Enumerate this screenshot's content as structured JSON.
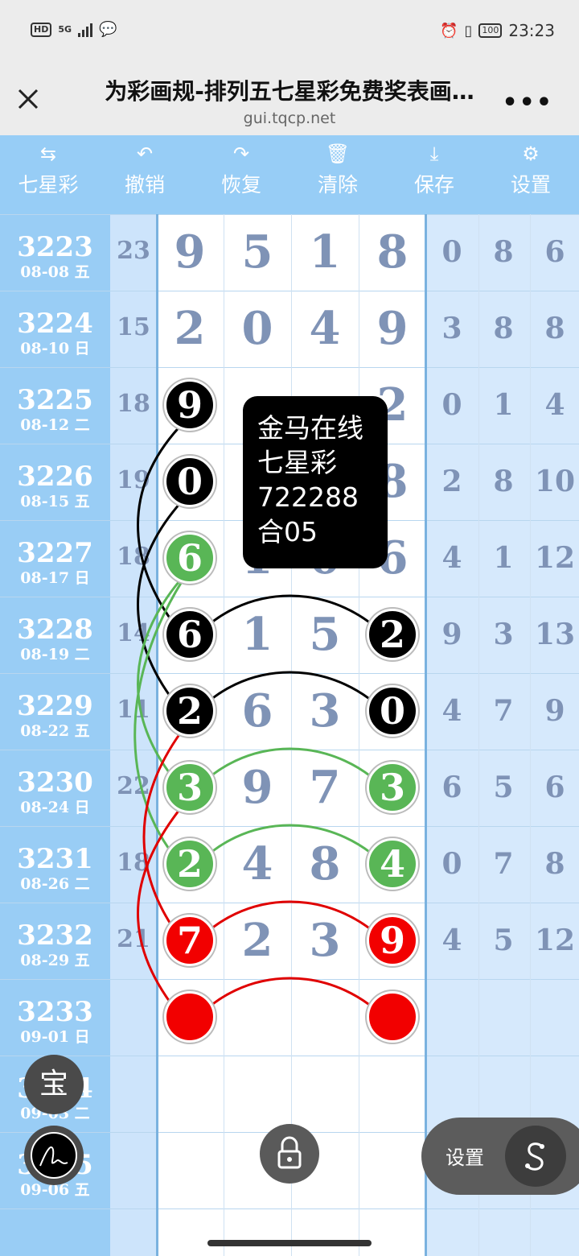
{
  "status_bar": {
    "hd": "HD",
    "signal": "5G",
    "time": "23:23",
    "battery": "100"
  },
  "header": {
    "title": "为彩画规-排列五七星彩免费奖表画…",
    "url": "gui.tqcp.net",
    "more": "•••"
  },
  "toolbar": [
    {
      "icon": "swap-icon",
      "glyph": "⇆",
      "label": "七星彩"
    },
    {
      "icon": "undo-icon",
      "glyph": "↶",
      "label": "撤销"
    },
    {
      "icon": "redo-icon",
      "glyph": "↷",
      "label": "恢复"
    },
    {
      "icon": "trash-icon",
      "glyph": "🗑",
      "label": "清除"
    },
    {
      "icon": "download-icon",
      "glyph": "⤓",
      "label": "保存"
    },
    {
      "icon": "gear-icon",
      "glyph": "⚙",
      "label": "设置"
    }
  ],
  "rows": [
    {
      "issue": "3223",
      "date": "08-08 五",
      "sum": "23",
      "main": [
        "9",
        "5",
        "1",
        "8"
      ],
      "right": [
        "0",
        "8",
        "6"
      ]
    },
    {
      "issue": "3224",
      "date": "08-10 日",
      "sum": "15",
      "main": [
        "2",
        "0",
        "4",
        "9"
      ],
      "right": [
        "3",
        "8",
        "8"
      ]
    },
    {
      "issue": "3225",
      "date": "08-12 二",
      "sum": "18",
      "main": [
        "",
        "",
        "",
        "2"
      ],
      "right": [
        "0",
        "1",
        "4"
      ]
    },
    {
      "issue": "3226",
      "date": "08-15 五",
      "sum": "19",
      "main": [
        "",
        "",
        "",
        "8"
      ],
      "right": [
        "2",
        "8",
        "10"
      ]
    },
    {
      "issue": "3227",
      "date": "08-17 日",
      "sum": "18",
      "main": [
        "",
        "1",
        "0",
        "6"
      ],
      "right": [
        "4",
        "1",
        "12"
      ]
    },
    {
      "issue": "3228",
      "date": "08-19 二",
      "sum": "14",
      "main": [
        "",
        "1",
        "5",
        ""
      ],
      "right": [
        "9",
        "3",
        "13"
      ]
    },
    {
      "issue": "3229",
      "date": "08-22 五",
      "sum": "11",
      "main": [
        "",
        "6",
        "3",
        ""
      ],
      "right": [
        "4",
        "7",
        "9"
      ]
    },
    {
      "issue": "3230",
      "date": "08-24 日",
      "sum": "22",
      "main": [
        "",
        "9",
        "7",
        ""
      ],
      "right": [
        "6",
        "5",
        "6"
      ]
    },
    {
      "issue": "3231",
      "date": "08-26 二",
      "sum": "18",
      "main": [
        "",
        "4",
        "8",
        ""
      ],
      "right": [
        "0",
        "7",
        "8"
      ]
    },
    {
      "issue": "3232",
      "date": "08-29 五",
      "sum": "21",
      "main": [
        "",
        "2",
        "3",
        ""
      ],
      "right": [
        "4",
        "5",
        "12"
      ]
    },
    {
      "issue": "3233",
      "date": "09-01 日",
      "sum": "",
      "main": [
        "",
        "",
        "",
        ""
      ],
      "right": [
        "",
        "",
        ""
      ]
    },
    {
      "issue": "3234",
      "date": "09-03 二",
      "sum": "",
      "main": [
        "",
        "",
        "",
        ""
      ],
      "right": [
        "",
        "",
        ""
      ]
    },
    {
      "issue": "3235",
      "date": "09-06 五",
      "sum": "",
      "main": [
        "",
        "",
        "",
        ""
      ],
      "right": [
        "",
        "",
        ""
      ]
    }
  ],
  "balls": [
    {
      "row": 2,
      "col": 0,
      "value": "9",
      "color": "black"
    },
    {
      "row": 3,
      "col": 0,
      "value": "0",
      "color": "black"
    },
    {
      "row": 4,
      "col": 0,
      "value": "6",
      "color": "green"
    },
    {
      "row": 5,
      "col": 0,
      "value": "6",
      "color": "black"
    },
    {
      "row": 5,
      "col": 3,
      "value": "2",
      "color": "black"
    },
    {
      "row": 6,
      "col": 0,
      "value": "2",
      "color": "black"
    },
    {
      "row": 6,
      "col": 3,
      "value": "0",
      "color": "black"
    },
    {
      "row": 7,
      "col": 0,
      "value": "3",
      "color": "green"
    },
    {
      "row": 7,
      "col": 3,
      "value": "3",
      "color": "green"
    },
    {
      "row": 8,
      "col": 0,
      "value": "2",
      "color": "green"
    },
    {
      "row": 8,
      "col": 3,
      "value": "4",
      "color": "green"
    },
    {
      "row": 9,
      "col": 0,
      "value": "7",
      "color": "red"
    },
    {
      "row": 9,
      "col": 3,
      "value": "9",
      "color": "red"
    },
    {
      "row": 10,
      "col": 0,
      "value": "",
      "color": "red"
    },
    {
      "row": 10,
      "col": 3,
      "value": "",
      "color": "red"
    }
  ],
  "tooltip": {
    "line1": "金马在线",
    "line2": "七星彩",
    "line3": "722288",
    "line4": "合05"
  },
  "floating": {
    "bao": "宝",
    "settings": "设置",
    "lock_icon": "lock-icon",
    "sign_icon": "signature-icon",
    "s_icon": "s-icon"
  },
  "colors": {
    "toolbar": "#97cdf6",
    "issue_col": "#99cdf5",
    "black": "#000000",
    "green": "#59b656",
    "red": "#f20000"
  }
}
